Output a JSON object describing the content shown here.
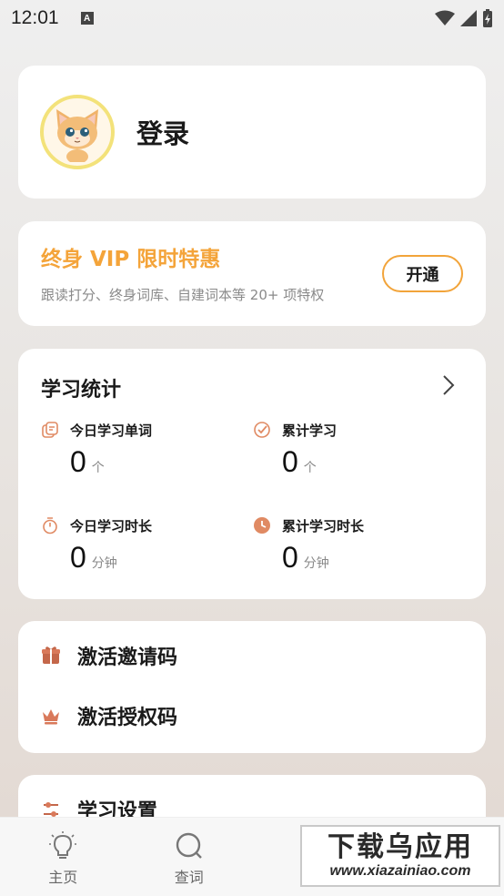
{
  "status_bar": {
    "time": "12:01",
    "a_icon": "A"
  },
  "login": {
    "label": "登录",
    "avatar": "cat-avatar"
  },
  "vip": {
    "title": "终身 VIP 限时特惠",
    "subtitle": "跟读打分、终身词库、自建词本等 20+ 项特权",
    "button": "开通",
    "accent": "#f4a43a"
  },
  "stats": {
    "title": "学习统计",
    "items": [
      {
        "label": "今日学习单词",
        "value": "0",
        "unit": "个",
        "icon": "cards-icon"
      },
      {
        "label": "累计学习",
        "value": "0",
        "unit": "个",
        "icon": "check-circle-icon"
      },
      {
        "label": "今日学习时长",
        "value": "0",
        "unit": "分钟",
        "icon": "stopwatch-icon"
      },
      {
        "label": "累计学习时长",
        "value": "0",
        "unit": "分钟",
        "icon": "clock-icon"
      }
    ]
  },
  "codes": {
    "invite": "激活邀请码",
    "license": "激活授权码"
  },
  "settings": {
    "label": "学习设置"
  },
  "nav": {
    "items": [
      {
        "label": "主页",
        "icon": "lightbulb-icon"
      },
      {
        "label": "查词",
        "icon": "search-icon"
      }
    ]
  },
  "watermark": {
    "title": "下载乌应用",
    "url": "www.xiazainiao.com"
  }
}
